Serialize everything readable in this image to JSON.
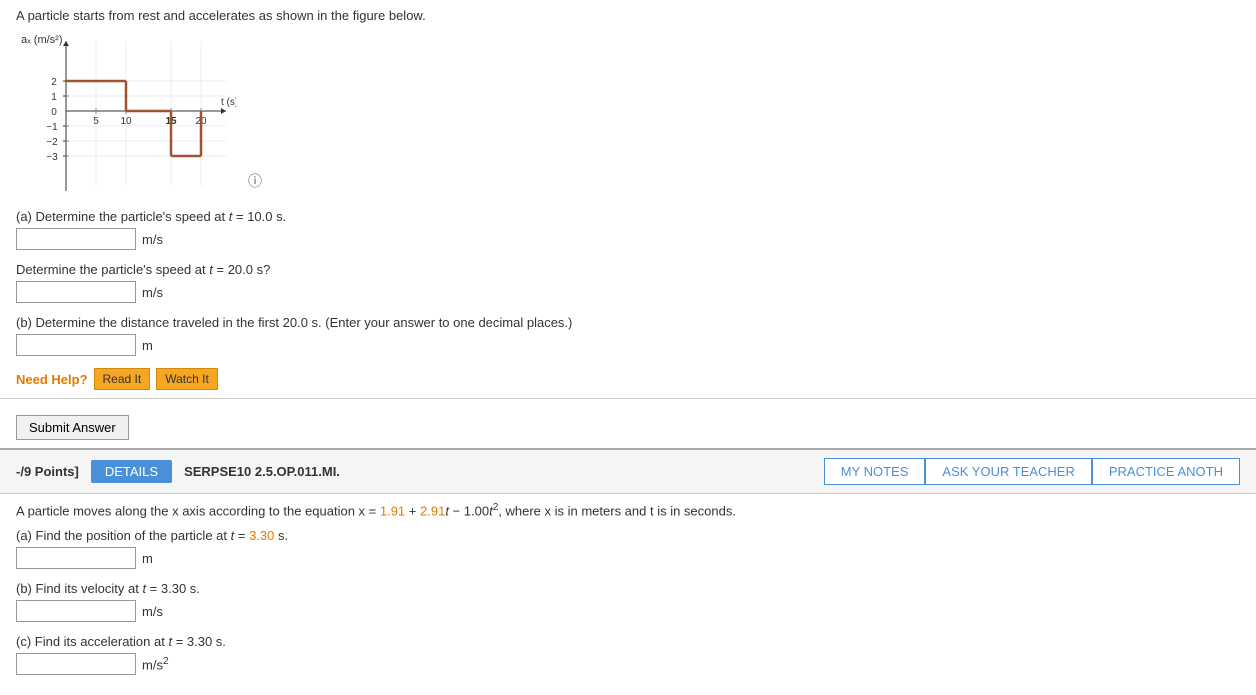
{
  "topSection": {
    "introText": "A particle starts from rest and accelerates as shown in the figure below.",
    "graph": {
      "yAxisLabel": "aₓ (m/s²)",
      "xAxisLabel": "t (s)",
      "yValues": [
        "2",
        "1",
        "0",
        "-1",
        "-2",
        "-3"
      ],
      "xValues": [
        "5",
        "10",
        "15",
        "20"
      ]
    },
    "questionA": {
      "label_part1": "(a) Determine the particle's speed at ",
      "label_t": "t",
      "label_part2": " = 10.0 s.",
      "unit1": "m/s",
      "label2_part1": "Determine the particle's speed at ",
      "label2_t": "t",
      "label2_part2": " = 20.0 s?",
      "unit2": "m/s"
    },
    "questionB": {
      "label_part1": "(b) Determine the distance traveled in the first 20.0 s. (Enter your answer to one decimal places.)",
      "unit": "m"
    },
    "needHelp": {
      "text": "Need Help?",
      "readItLabel": "Read It",
      "watchItLabel": "Watch It"
    },
    "submitLabel": "Submit Answer"
  },
  "bottomSection": {
    "pointsLabel": "-/9 Points]",
    "detailsLabel": "DETAILS",
    "problemId": "SERPSE10 2.5.OP.011.MI.",
    "myNotesLabel": "MY NOTES",
    "askTeacherLabel": "ASK YOUR TEACHER",
    "practiceLabel": "PRACTICE ANOTH",
    "problemDesc_part1": "A particle moves along the x axis according to the equation x = ",
    "val1": "1.91",
    "op1": " + ",
    "val2": "2.91",
    "var1": "t",
    "op2": " − 1.00",
    "var2": "t",
    "exp": "2",
    "desc_end": ", where x is in meters and t is in seconds.",
    "questionA": {
      "label_part1": "(a) Find the position of the particle at ",
      "label_t": "t",
      "label_part2": " = ",
      "val": "3.30",
      "label_part3": " s.",
      "unit": "m"
    },
    "questionB": {
      "label_part1": "(b) Find its velocity at ",
      "label_t": "t",
      "label_part2": " = 3.30 s.",
      "unit": "m/s"
    },
    "questionC": {
      "label_part1": "(c) Find its acceleration at ",
      "label_t": "t",
      "label_part2": " = 3.30 s.",
      "unit": "m/s²"
    }
  }
}
